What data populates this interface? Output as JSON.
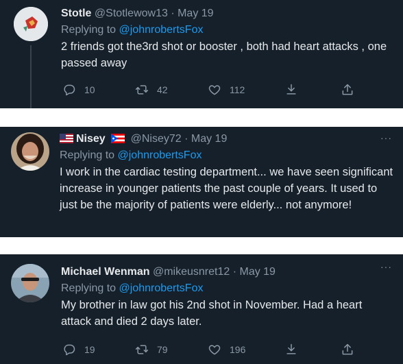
{
  "tweets": [
    {
      "name": "Stotle",
      "handle": "@Stotlewow13",
      "date": "May 19",
      "replying_prefix": "Replying to ",
      "replying_to": "@johnrobertsFox",
      "text": "2 friends got the3rd shot or booster , both had heart attacks , one passed away",
      "counts": {
        "replies": "10",
        "retweets": "42",
        "likes": "112"
      }
    },
    {
      "name": "Nisey",
      "handle": "@Nisey72",
      "date": "May 19",
      "replying_prefix": "Replying to ",
      "replying_to": "@johnrobertsFox",
      "text": "I work in the cardiac testing department... we have seen significant increase in younger patients the past couple of years. It used to just be the majority of patients were elderly... not anymore!",
      "more": "···"
    },
    {
      "name": "Michael Wenman",
      "handle": "@mikeusnret12",
      "date": "May 19",
      "replying_prefix": "Replying to ",
      "replying_to": "@johnrobertsFox",
      "text": "My brother in law got his 2nd shot in November.  Had a heart attack and died 2 days later.",
      "more": "···",
      "counts": {
        "replies": "19",
        "retweets": "79",
        "likes": "196"
      }
    }
  ],
  "separator": " · ",
  "icons": [
    "reply-icon",
    "retweet-icon",
    "like-icon",
    "download-icon",
    "share-icon",
    "more-icon",
    "us-flag-icon",
    "puerto-rico-flag-icon"
  ],
  "colors": {
    "background": "#15202b",
    "link": "#1d9bf0",
    "muted": "#8b98a5",
    "text": "#e7e9ea",
    "gap": "#ffffff"
  }
}
